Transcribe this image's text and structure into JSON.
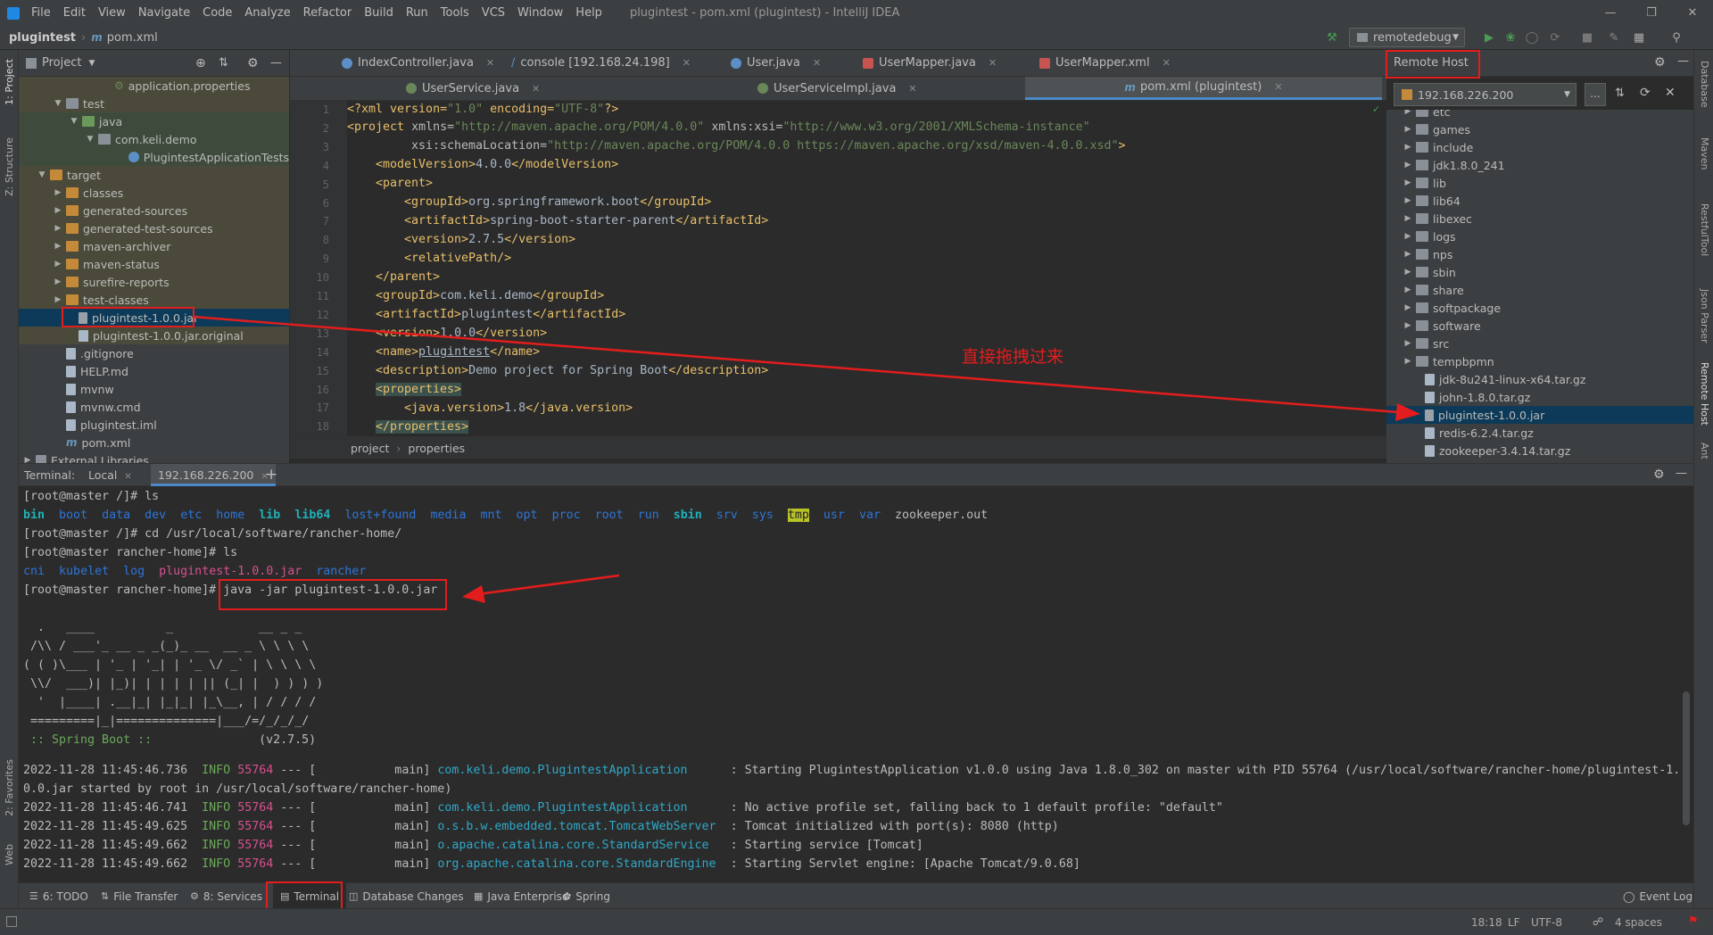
{
  "menu": [
    "File",
    "Edit",
    "View",
    "Navigate",
    "Code",
    "Analyze",
    "Refactor",
    "Build",
    "Run",
    "Tools",
    "VCS",
    "Window",
    "Help"
  ],
  "window_title": "plugintest - pom.xml (plugintest) - IntelliJ IDEA",
  "nav": {
    "project": "plugintest",
    "file": "pom.xml",
    "run_config": "remotedebug"
  },
  "project_panel": {
    "title": "Project",
    "rows": [
      {
        "label": "application.properties"
      },
      {
        "label": "test"
      },
      {
        "label": "java"
      },
      {
        "label": "com.keli.demo"
      },
      {
        "label": "PlugintestApplicationTests"
      },
      {
        "label": "target"
      },
      {
        "label": "classes"
      },
      {
        "label": "generated-sources"
      },
      {
        "label": "generated-test-sources"
      },
      {
        "label": "maven-archiver"
      },
      {
        "label": "maven-status"
      },
      {
        "label": "surefire-reports"
      },
      {
        "label": "test-classes"
      },
      {
        "label": "plugintest-1.0.0.jar"
      },
      {
        "label": "plugintest-1.0.0.jar.original"
      },
      {
        "label": ".gitignore"
      },
      {
        "label": "HELP.md"
      },
      {
        "label": "mvnw"
      },
      {
        "label": "mvnw.cmd"
      },
      {
        "label": "plugintest.iml"
      },
      {
        "label": "pom.xml"
      },
      {
        "label": "External Libraries"
      }
    ]
  },
  "editor_tabs_row1": [
    "IndexController.java",
    "console [192.168.24.198]",
    "User.java",
    "UserMapper.java",
    "UserMapper.xml"
  ],
  "editor_tabs_row2": [
    "UserService.java",
    "UserServiceImpl.java",
    "pom.xml (plugintest)"
  ],
  "code": {
    "line_numbers": [
      "1",
      "2",
      "3",
      "4",
      "5",
      "6",
      "7",
      "8",
      "9",
      "10",
      "11",
      "12",
      "13",
      "14",
      "15",
      "16",
      "17",
      "18"
    ],
    "l1a": "<?xml version=",
    "l1b": "\"1.0\"",
    "l1c": " encoding=",
    "l1d": "\"UTF-8\"",
    "l1e": "?>",
    "l2a": "<project ",
    "l2b": "xmlns=",
    "l2c": "\"http://maven.apache.org/POM/4.0.0\"",
    "l2d": " xmlns:xsi=",
    "l2e": "\"http://www.w3.org/2001/XMLSchema-instance\"",
    "l3a": "xsi:schemaLocation=",
    "l3b": "\"http://maven.apache.org/POM/4.0.0 https://maven.apache.org/xsd/maven-4.0.0.xsd\"",
    "l3c": ">",
    "l4a": "<modelVersion>",
    "l4b": "4.0.0",
    "l4c": "</modelVersion>",
    "l5": "<parent>",
    "l6a": "<groupId>",
    "l6b": "org.springframework.boot",
    "l6c": "</groupId>",
    "l7a": "<artifactId>",
    "l7b": "spring-boot-starter-parent",
    "l7c": "</artifactId>",
    "l8a": "<version>",
    "l8b": "2.7.5",
    "l8c": "</version>",
    "l9": "<relativePath/>",
    "l10": "</parent>",
    "l11a": "<groupId>",
    "l11b": "com.keli.demo",
    "l11c": "</groupId>",
    "l12a": "<artifactId>",
    "l12b": "plugintest",
    "l12c": "</artifactId>",
    "l13a": "<version>",
    "l13b": "1.0.0",
    "l13c": "</version>",
    "l14a": "<name>",
    "l14b": "plugintest",
    "l14c": "</name>",
    "l15a": "<description>",
    "l15b": "Demo project for Spring Boot",
    "l15c": "</description>",
    "l16": "<properties>",
    "l17a": "<java.version>",
    "l17b": "1.8",
    "l17c": "</java.version>",
    "l18": "</properties>"
  },
  "breadcrumb": [
    "project",
    "properties"
  ],
  "annotation": "直接拖拽过来",
  "remote_host": {
    "title": "Remote Host",
    "host": "192.168.226.200",
    "items": [
      "etc",
      "games",
      "include",
      "jdk1.8.0_241",
      "lib",
      "lib64",
      "libexec",
      "logs",
      "nps",
      "sbin",
      "share",
      "softpackage",
      "software",
      "src",
      "tempbpmn",
      "jdk-8u241-linux-x64.tar.gz",
      "john-1.8.0.tar.gz",
      "plugintest-1.0.0.jar",
      "redis-6.2.4.tar.gz",
      "zookeeper-3.4.14.tar.gz"
    ]
  },
  "terminal": {
    "label": "Terminal:",
    "tabs": [
      "Local",
      "192.168.226.200"
    ],
    "prompt1": "[root@master /]# ls",
    "ls1": [
      "bin",
      "boot",
      "data",
      "dev",
      "etc",
      "home",
      "lib",
      "lib64",
      "lost+found",
      "media",
      "mnt",
      "opt",
      "proc",
      "root",
      "run",
      "sbin",
      "srv",
      "sys",
      "tmp",
      "usr",
      "var",
      "zookeeper.out"
    ],
    "prompt2": "[root@master /]# cd /usr/local/software/rancher-home/",
    "prompt3": "[root@master rancher-home]# ls",
    "ls2": [
      "cni",
      "kubelet",
      "log",
      "plugintest-1.0.0.jar",
      "rancher"
    ],
    "prompt4": "[root@master rancher-home]#",
    "cmd4": " java -jar plugintest-1.0.0.jar",
    "banner": [
      "  .   ____          _            __ _ _",
      " /\\\\ / ___'_ __ _ _(_)_ __  __ _ \\ \\ \\ \\",
      "( ( )\\___ | '_ | '_| | '_ \\/ _` | \\ \\ \\ \\",
      " \\\\/  ___)| |_)| | | | | || (_| |  ) ) ) )",
      "  '  |____| .__|_| |_|_| |_\\__, | / / / /",
      " =========|_|==============|___/=/_/_/_/"
    ],
    "spring_label": " :: Spring Boot ::",
    "spring_ver": "(v2.7.5)",
    "logs": [
      {
        "ts": "2022-11-28 11:45:46.736",
        "lvl": "INFO",
        "pid": "55764",
        "mid": " --- [           main] ",
        "cls": "com.keli.demo.PlugintestApplication     ",
        "msg": " : Starting PlugintestApplication v1.0.0 using Java 1.8.0_302 on master with PID 55764 (/usr/local/software/rancher-home/plugintest-1."
      },
      {
        "ts": "0.0.jar started by root in /usr/local/software/rancher-home)",
        "lvl": "",
        "pid": "",
        "mid": "",
        "cls": "",
        "msg": ""
      },
      {
        "ts": "2022-11-28 11:45:46.741",
        "lvl": "INFO",
        "pid": "55764",
        "mid": " --- [           main] ",
        "cls": "com.keli.demo.PlugintestApplication     ",
        "msg": " : No active profile set, falling back to 1 default profile: \"default\""
      },
      {
        "ts": "2022-11-28 11:45:49.625",
        "lvl": "INFO",
        "pid": "55764",
        "mid": " --- [           main] ",
        "cls": "o.s.b.w.embedded.tomcat.TomcatWebServer ",
        "msg": " : Tomcat initialized with port(s): 8080 (http)"
      },
      {
        "ts": "2022-11-28 11:45:49.662",
        "lvl": "INFO",
        "pid": "55764",
        "mid": " --- [           main] ",
        "cls": "o.apache.catalina.core.StandardService  ",
        "msg": " : Starting service [Tomcat]"
      },
      {
        "ts": "2022-11-28 11:45:49.662",
        "lvl": "INFO",
        "pid": "55764",
        "mid": " --- [           main] ",
        "cls": "org.apache.catalina.core.StandardEngine ",
        "msg": " : Starting Servlet engine: [Apache Tomcat/9.0.68]"
      }
    ]
  },
  "bottom_tabs": [
    "6: TODO",
    "File Transfer",
    "8: Services",
    "Terminal",
    "Database Changes",
    "Java Enterprise",
    "Spring"
  ],
  "event_log": "Event Log",
  "status": {
    "pos": "18:18",
    "lf": "LF",
    "enc": "UTF-8",
    "indent": "4 spaces"
  },
  "left_stripe": [
    "1: Project",
    "Z: Structure",
    "2: Favorites",
    "Web"
  ],
  "right_stripe": [
    "Database",
    "Maven",
    "RestfulTool",
    "Json Parser",
    "Remote Host",
    "Ant"
  ],
  "colors": {
    "accent": "#4a88c7",
    "annotation_red": "#e31d1d"
  }
}
